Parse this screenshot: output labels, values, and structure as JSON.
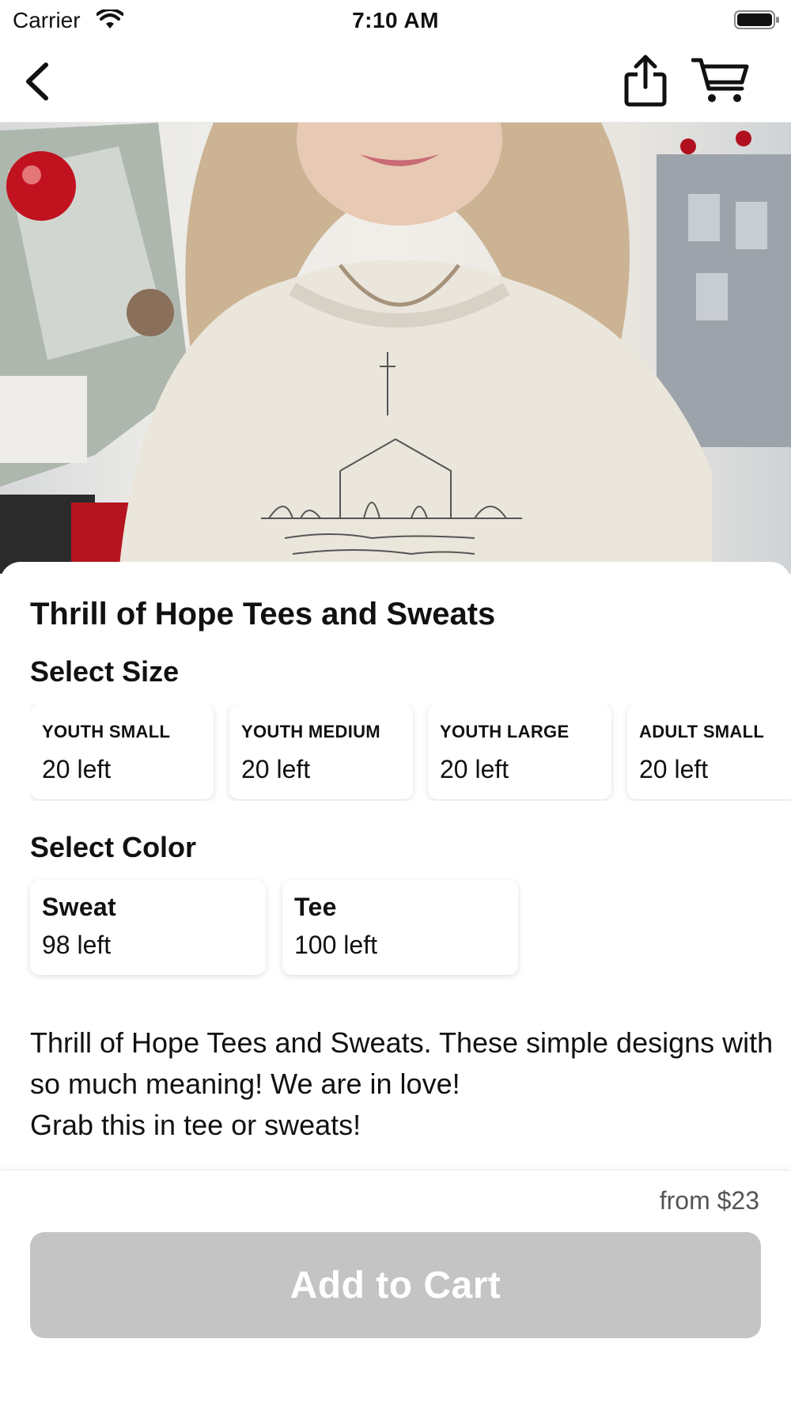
{
  "status_bar": {
    "carrier": "Carrier",
    "time": "7:10 AM"
  },
  "nav": {
    "back_icon": "chevron-left-icon",
    "share_icon": "share-icon",
    "cart_icon": "cart-icon"
  },
  "product": {
    "title": "Thrill of Hope Tees and Sweats",
    "size_label": "Select Size",
    "sizes": [
      {
        "name": "YOUTH SMALL",
        "stock": "20 left"
      },
      {
        "name": "YOUTH MEDIUM",
        "stock": "20 left"
      },
      {
        "name": "YOUTH LARGE",
        "stock": "20 left"
      },
      {
        "name": "ADULT SMALL",
        "stock": "20 left"
      }
    ],
    "color_label": "Select Color",
    "colors": [
      {
        "name": "Sweat",
        "stock": "98 left"
      },
      {
        "name": "Tee",
        "stock": "100 left"
      }
    ],
    "description": "Thrill of Hope Tees and Sweats. These simple designs with so much meaning!  We are in love!\nGrab this in tee or sweats!"
  },
  "bottom_bar": {
    "price": "from $23",
    "add_to_cart_label": "Add to Cart",
    "button_color": "#c4c4c4"
  }
}
